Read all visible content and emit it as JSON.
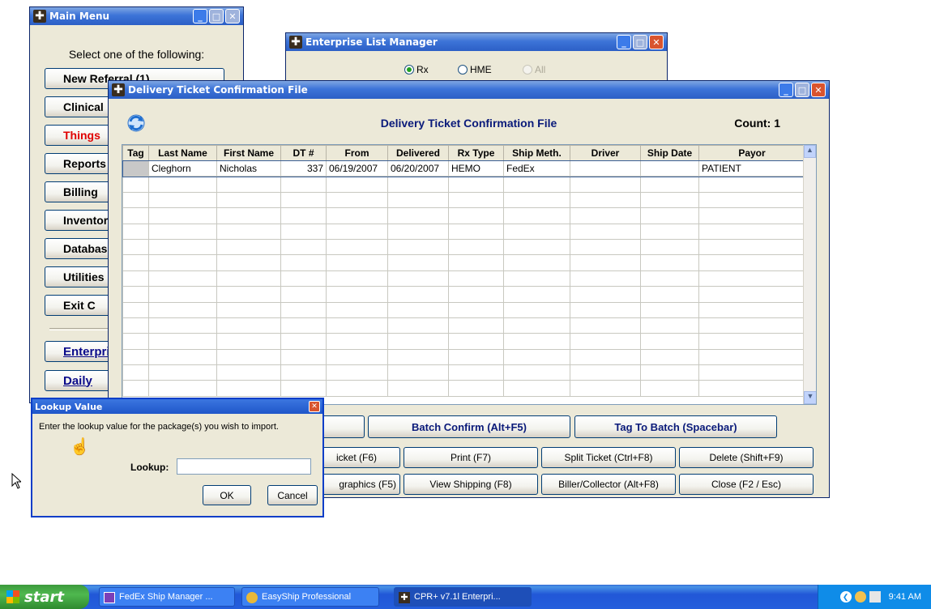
{
  "main_menu": {
    "title": "Main Menu",
    "prompt": "Select one of the following:",
    "buttons": [
      "New Referral (1)",
      "Clinical",
      "Things",
      "Reports",
      "Billing",
      "Inventory",
      "Database",
      "Utilities",
      "Exit C"
    ],
    "lower_buttons": [
      "Enterprise",
      "Daily"
    ]
  },
  "list_manager": {
    "title": "Enterprise List Manager",
    "radio_options": [
      "Rx",
      "HME",
      "All"
    ]
  },
  "dtc": {
    "title": "Delivery Ticket Confirmation File",
    "heading": "Delivery Ticket Confirmation File",
    "count_label": "Count: 1",
    "columns": [
      "Tag",
      "Last Name",
      "First Name",
      "DT #",
      "From",
      "Delivered",
      "Rx Type",
      "Ship Meth.",
      "Driver",
      "Ship Date",
      "Payor"
    ],
    "rows": [
      [
        "",
        "Cleghorn",
        "Nicholas",
        "337",
        "06/19/2007",
        "06/20/2007",
        "HEMO",
        "FedEx",
        "",
        "",
        "PATIENT"
      ]
    ],
    "buttons_row1": [
      "Batch Confirm (Alt+F5)",
      "Tag To Batch (Spacebar)"
    ],
    "buttons_row2": [
      "icket (F6)",
      "Print (F7)",
      "Split Ticket (Ctrl+F8)",
      "Delete (Shift+F9)"
    ],
    "buttons_row3": [
      "graphics (F5)",
      "View Shipping (F8)",
      "Biller/Collector (Alt+F8)",
      "Close (F2 / Esc)"
    ]
  },
  "lookup": {
    "title": "Lookup Value",
    "message": "Enter the lookup value for the package(s) you wish to import.",
    "field_label": "Lookup:",
    "field_value": "",
    "ok_label": "OK",
    "cancel_label": "Cancel"
  },
  "taskbar": {
    "start_label": "start",
    "tasks": [
      "FedEx Ship Manager ...",
      "EasyShip Professional",
      "CPR+ v7.1l  Enterpri..."
    ],
    "clock": "9:41 AM"
  }
}
